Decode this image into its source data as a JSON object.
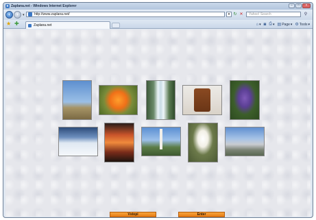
{
  "window": {
    "title": "Zaplana.net - Windows Internet Explorer"
  },
  "address": {
    "url": "http://www.zaplana.net/",
    "search_placeholder": "Yahoo! Search"
  },
  "tabs": [
    {
      "label": "Zaplana.net"
    }
  ],
  "commands": {
    "page_label": "Page",
    "tools_label": "Tools"
  },
  "photos": [
    {
      "subject": "bare-tree"
    },
    {
      "subject": "orange-lily"
    },
    {
      "subject": "waterfall"
    },
    {
      "subject": "cuckoo-clock"
    },
    {
      "subject": "purple-bellflower"
    },
    {
      "subject": "winter-sun-snow"
    },
    {
      "subject": "sunset"
    },
    {
      "subject": "church"
    },
    {
      "subject": "white-crocus"
    },
    {
      "subject": "mountains"
    }
  ],
  "buttons": {
    "vstopi": "Vstopi",
    "enter": "Enter"
  },
  "colors": {
    "button_orange": "#f08a24",
    "background": "#e6e7ec",
    "chrome": "#dfe7f1"
  }
}
